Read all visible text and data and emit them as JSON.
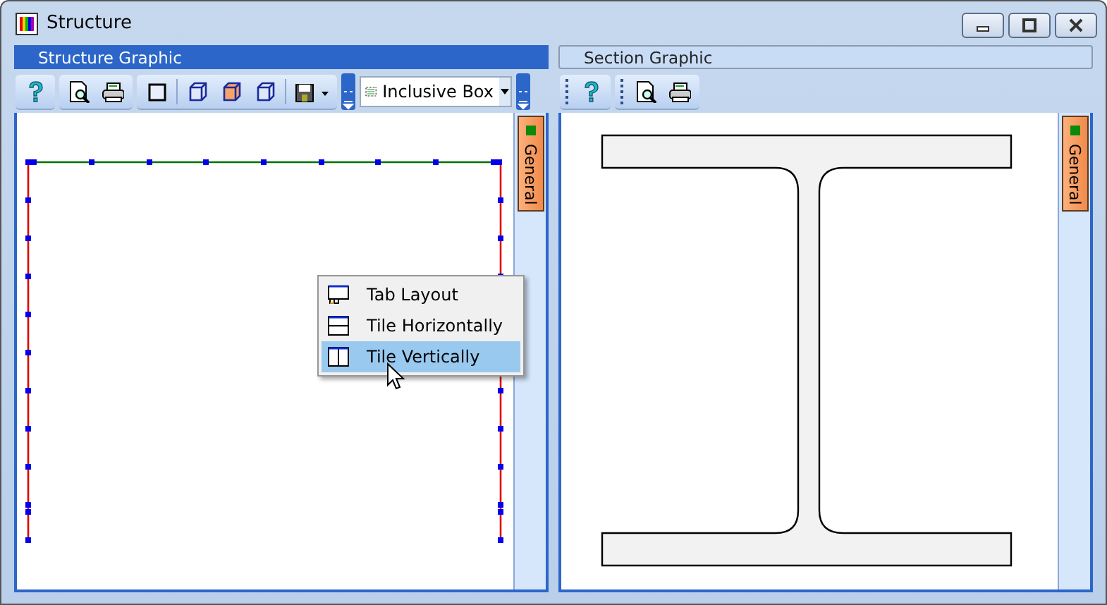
{
  "window": {
    "title": "Structure"
  },
  "panels": [
    {
      "title": "Structure Graphic",
      "selected": true,
      "kind": "structure",
      "combo": {
        "value": "Inclusive Box"
      },
      "side_tab": "General"
    },
    {
      "title": "Section Graphic",
      "selected": false,
      "kind": "section",
      "side_tab": "General"
    }
  ],
  "context_menu": {
    "items": [
      {
        "label": "Tab Layout",
        "kind": "tabs",
        "selected": false
      },
      {
        "label": "Tile Horizontally",
        "kind": "horizontal",
        "selected": false
      },
      {
        "label": "Tile Vertically",
        "kind": "vertical",
        "selected": true
      }
    ]
  }
}
